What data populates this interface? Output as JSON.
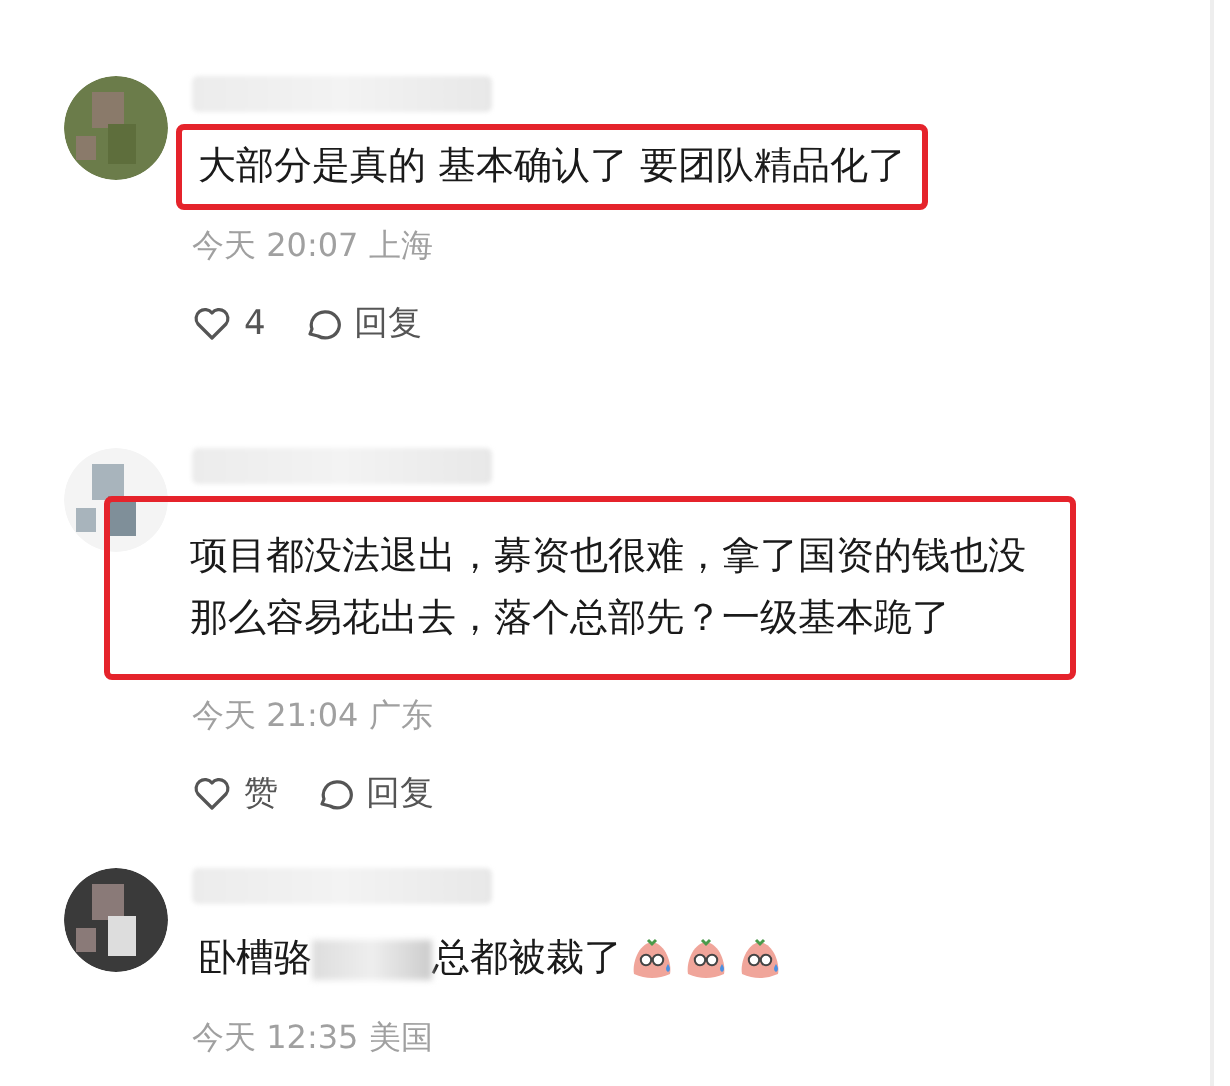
{
  "comments": [
    {
      "text_parts": [
        "大部分是真的 基本确认了 要团队精品化了"
      ],
      "highlighted": true,
      "time": "今天 20:07 上海",
      "like_label": "4",
      "reply_label": "回复"
    },
    {
      "text_parts": [
        "项目都没法退出，募资也很难，拿了国资的钱也没那么容易花出去，落个总部先？一级基本跪了"
      ],
      "highlighted": true,
      "time": "今天 21:04 广东",
      "like_label": "赞",
      "reply_label": "回复"
    },
    {
      "text_parts": [
        "卧槽骆",
        "总都被裁了"
      ],
      "highlighted": false,
      "time": "今天 12:35 美国",
      "emojis": [
        {
          "kind": "sweat-face"
        },
        {
          "kind": "sweat-face"
        },
        {
          "kind": "sweat-face"
        }
      ]
    }
  ]
}
